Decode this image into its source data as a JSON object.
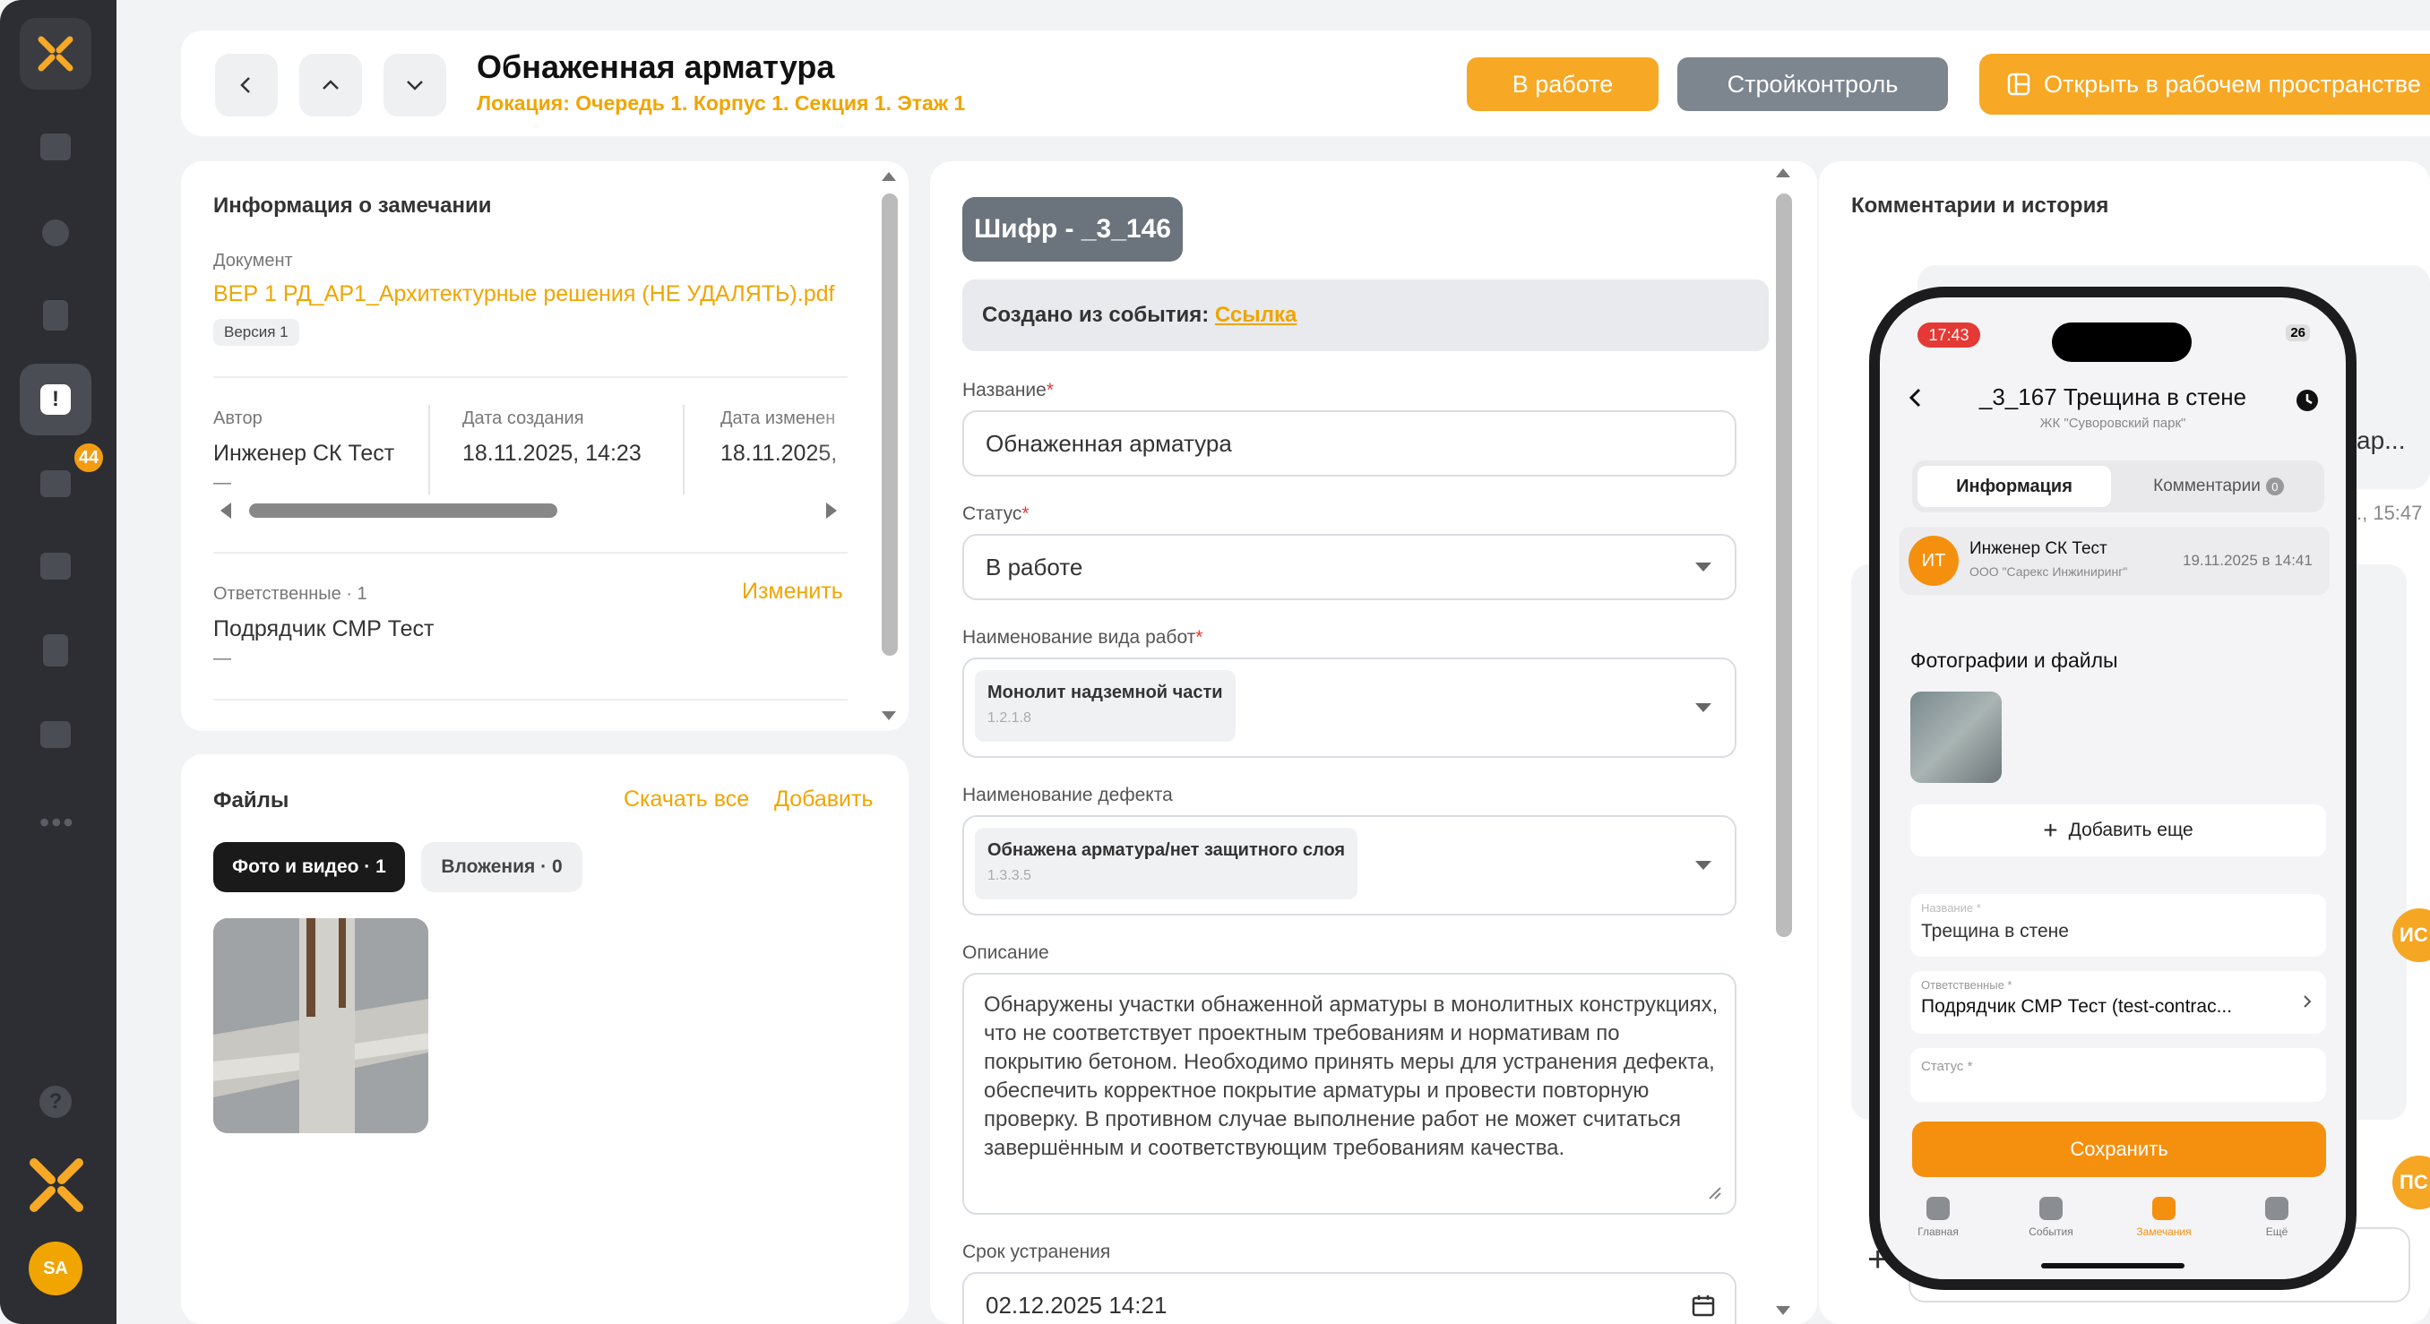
{
  "sidebar": {
    "badge": "44",
    "avatar": "SA",
    "help": "?",
    "more": "•••"
  },
  "header": {
    "title": "Обнаженная арматура",
    "location": "Локация:  Очередь 1. Корпус 1. Секция 1. Этаж 1",
    "status_button": "В работе",
    "control_button": "Стройконтроль",
    "open_button": "Открыть в рабочем пространстве"
  },
  "info": {
    "section_title": "Информация о замечании",
    "document_label": "Документ",
    "document_link": "ВЕР 1 РД_АР1_Архитектурные решения (НЕ УДАЛЯТЬ).pdf",
    "version": "Версия 1",
    "author_label": "Автор",
    "author": "Инженер СК Тест",
    "author_sub": "—",
    "created_label": "Дата создания",
    "created": "18.11.2025, 14:23",
    "changed_label": "Дата изменен",
    "changed": "18.11.2025,",
    "responsible_label": "Ответственные · 1",
    "responsible_change": "Изменить",
    "responsible": "Подрядчик СМР Тест",
    "responsible_sub": "—"
  },
  "files": {
    "title": "Файлы",
    "download_all": "Скачать все",
    "add": "Добавить",
    "tab_media": "Фото и видео · 1",
    "tab_attach": "Вложения · 0"
  },
  "form": {
    "code": "Шифр - _3_146",
    "created_from": "Создано из события:",
    "created_from_link": "Ссылка",
    "name_label": "Название",
    "name_value": "Обнаженная арматура",
    "status_label": "Статус",
    "status_value": "В работе",
    "work_label": "Наименование вида работ",
    "work_value": "Монолит надземной части",
    "work_code": "1.2.1.8",
    "defect_label": "Наименование дефекта",
    "defect_value": "Обнажена арматура/нет защитного слоя",
    "defect_code": "1.3.3.5",
    "description_label": "Описание",
    "description": "Обнаружены участки обнаженной арматуры в монолитных конструкциях, что не соответствует проектным требованиям и нормативам по покрытию бетоном. Необходимо принять меры для устранения дефекта, обеспечить корректное покрытие арматуры и провести повторную проверку. В противном случае выполнение работ не может считаться завершённым и соответствующим требованиям качества.",
    "deadline_label": "Срок устранения",
    "deadline_value": "02.12.2025 14:21",
    "required_mark": "*"
  },
  "comments": {
    "title": "Комментарии и история",
    "peek_text": "ар...",
    "peek_time": "., 15:47",
    "peek_avatar1": "ИС",
    "peek_avatar2": "ПС"
  },
  "phone": {
    "time": "17:43",
    "battery": "26",
    "title": "_3_167 Трещина в стене",
    "subtitle": "ЖК \"Суворовский парк\"",
    "tab_info": "Информация",
    "tab_comments": "Комментарии",
    "tab_comments_count": "0",
    "author_initials": "ИТ",
    "author_name": "Инженер СК Тест",
    "author_org": "ООО \"Сарекс Инжиниринг\"",
    "author_date": "19.11.2025 в 14:41",
    "photos_title": "Фотографии и файлы",
    "add_more": "Добавить еще",
    "name_label": "Название *",
    "name_value": "Трещина в стене",
    "resp_label": "Ответственные *",
    "resp_value": "Подрядчик СМР Тест (test-contrac...",
    "status_label": "Статус *",
    "save": "Сохранить",
    "nav": [
      "Главная",
      "События",
      "Замечания",
      "Ещё"
    ]
  },
  "colors": {
    "accent": "#f7a824",
    "sidebar": "#2c2e33",
    "control": "#7d858f",
    "save": "#f5900f"
  }
}
